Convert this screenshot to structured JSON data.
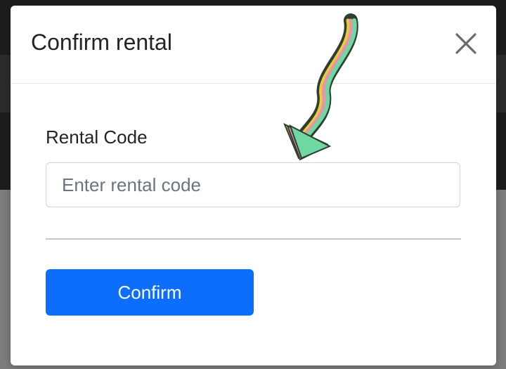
{
  "dialog": {
    "title": "Confirm rental",
    "close_icon": "close-icon"
  },
  "form": {
    "rental_code_label": "Rental Code",
    "rental_code_value": "",
    "rental_code_placeholder": "Enter rental code",
    "confirm_label": "Confirm"
  },
  "annotation": {
    "icon": "rainbow-arrow-icon",
    "colors": [
      "#e8cc3a",
      "#ee8fb1",
      "#6fd7a2"
    ]
  },
  "theme": {
    "primary": "#0d6efd",
    "overlay_dark": "#1d1d1e",
    "overlay_light": "#7c7c7c"
  }
}
